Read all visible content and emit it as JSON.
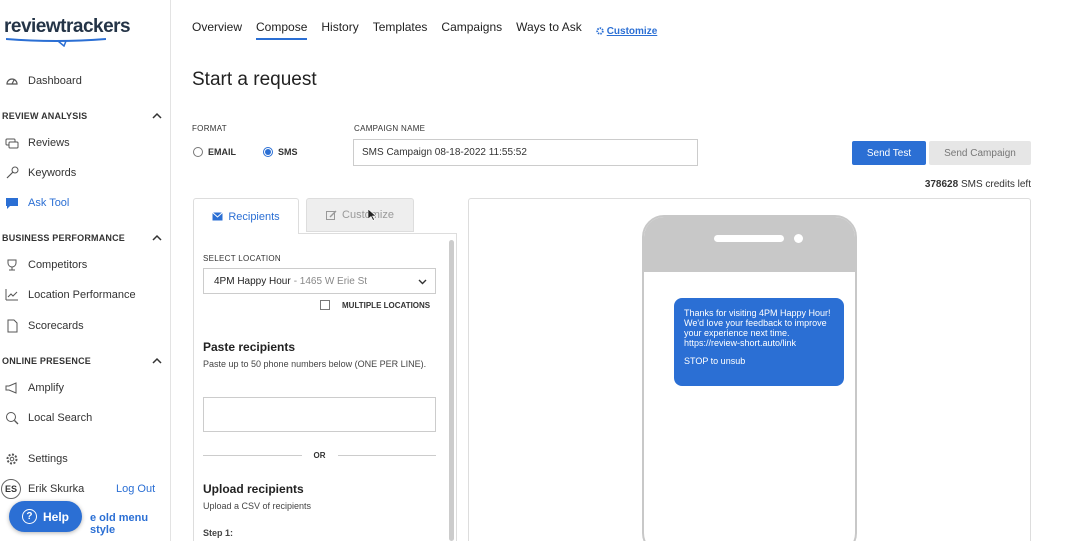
{
  "sidebar": {
    "logo": "reviewtrackers",
    "dashboard": "Dashboard",
    "sections": [
      {
        "title": "REVIEW ANALYSIS",
        "items": [
          "Reviews",
          "Keywords",
          "Ask Tool"
        ]
      },
      {
        "title": "BUSINESS PERFORMANCE",
        "items": [
          "Competitors",
          "Location Performance",
          "Scorecards"
        ]
      },
      {
        "title": "ONLINE PRESENCE",
        "items": [
          "Amplify",
          "Local Search"
        ]
      }
    ],
    "settings": "Settings",
    "user_initials": "ES",
    "user_name": "Erik Skurka",
    "logout": "Log Out",
    "old_menu": "e old menu style",
    "help": "Help",
    "help_symbol": "?"
  },
  "top_tabs": [
    "Overview",
    "Compose",
    "History",
    "Templates",
    "Campaigns",
    "Ways to Ask"
  ],
  "top_customize": "Customize",
  "page_title": "Start a request",
  "format": {
    "label": "FORMAT",
    "email": "EMAIL",
    "sms": "SMS",
    "selected": "SMS"
  },
  "campaign": {
    "label": "CAMPAIGN NAME",
    "value": "SMS Campaign 08-18-2022 11:55:52"
  },
  "buttons": {
    "send_test": "Send Test",
    "send_campaign": "Send Campaign"
  },
  "credits": {
    "count": "378628",
    "text": "SMS credits left"
  },
  "panel_tabs": {
    "recipients": "Recipients",
    "customize": "Customize"
  },
  "location": {
    "label": "SELECT LOCATION",
    "name": "4PM Happy Hour",
    "address": "- 1465 W Erie St",
    "multiple": "MULTIPLE LOCATIONS"
  },
  "paste": {
    "title": "Paste recipients",
    "desc": "Paste up to 50 phone numbers below (ONE PER LINE)."
  },
  "or_text": "OR",
  "upload": {
    "title": "Upload recipients",
    "desc": "Upload a CSV of recipients",
    "step": "Step 1:"
  },
  "preview": {
    "message": "Thanks for visiting 4PM Happy Hour! We'd love your feedback to improve your experience next time. https://review-short.auto/link",
    "stop": "STOP to unsub"
  },
  "colors": {
    "accent": "#2b6fd4",
    "phone_frame": "#c8c8c8"
  }
}
